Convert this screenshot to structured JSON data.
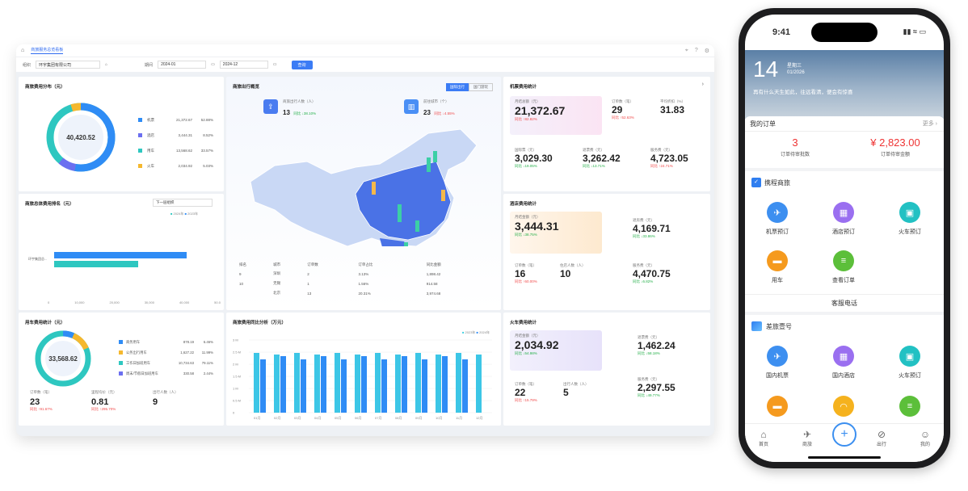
{
  "dashboard": {
    "tab": "商旅服务总览看板",
    "filter": {
      "org_label": "组织",
      "org_value": "环宇集团有限公司",
      "period_label": "期间",
      "start": "2024-01",
      "end": "2024-12",
      "search": "查询"
    },
    "spend": {
      "title": "商旅费用分布（元）",
      "total": "40,420.52",
      "items": [
        {
          "name": "机票",
          "amount": "21,372.67",
          "pct": "52.88%",
          "color": "#2f8cf5"
        },
        {
          "name": "酒店",
          "amount": "3,444.31",
          "pct": "8.52%",
          "color": "#6b6ff0"
        },
        {
          "name": "用车",
          "amount": "13,568.62",
          "pct": "33.57%",
          "color": "#2ec7c0"
        },
        {
          "name": "火车",
          "amount": "2,034.92",
          "pct": "5.03%",
          "color": "#f5b82e"
        }
      ]
    },
    "rank": {
      "title": "商旅总体费用排名（元）",
      "select": "下一层组织",
      "legend": [
        "2024年",
        "2023年"
      ],
      "category": "环宇集团总...",
      "ticks": [
        "0",
        "10,000",
        "20,000",
        "30,000",
        "40,000",
        "50.0"
      ]
    },
    "overview": {
      "title": "商旅出行概览",
      "tabs": [
        "国际出行",
        "国门游玩"
      ],
      "trips_label": "商旅出行人数（人）",
      "trips": "13",
      "trips_change": "同比 ↓38.10%",
      "cities_label": "前往城市（个）",
      "cities": "23",
      "cities_change": "同比 ↓4.55%",
      "columns": [
        "排名",
        "城市",
        "订单数",
        "订单占比",
        "同比金额"
      ],
      "rows": [
        [
          "9",
          "深圳",
          "2",
          "3.13%",
          "1,898.42"
        ],
        [
          "10",
          "无锡",
          "1",
          "1.56%",
          "914.58"
        ],
        [
          "",
          "北京",
          "13",
          "20.31%",
          "3,974.68"
        ]
      ]
    },
    "car": {
      "title": "用车费用统计（元）",
      "total": "33,568.62",
      "items": [
        {
          "name": "商务用车",
          "amount": "878.19",
          "pct": "6.46%",
          "color": "#2f8cf5"
        },
        {
          "name": "公务出行用车",
          "amount": "1,627.22",
          "pct": "11.99%",
          "color": "#f5b82e"
        },
        {
          "name": "工作日加班用车",
          "amount": "10,734.63",
          "pct": "79.11%",
          "color": "#2ec7c0"
        },
        {
          "name": "周末/节假日加班用车",
          "amount": "330.58",
          "pct": "2.44%",
          "color": "#6b6ff0"
        }
      ],
      "orders_label": "订单数（笔）",
      "orders": "23",
      "orders_change": "同比 ↑91.67%",
      "avg_label": "里程均价（元）",
      "avg": "0.81",
      "avg_change": "同比 ↑295.70%",
      "people_label": "出行人数（人）",
      "people": "9"
    },
    "yoy": {
      "title": "商旅费用同比分析（万元）",
      "legend": [
        "2023年",
        "2024年"
      ],
      "months": [
        "01月",
        "02月",
        "03月",
        "04月",
        "05月",
        "06月",
        "07月",
        "08月",
        "09月",
        "10月",
        "11月",
        "12月"
      ],
      "y_ticks": [
        "0",
        "0.5 M",
        "1 M",
        "1.5 M",
        "2 M",
        "2.5 M",
        "3 M"
      ]
    },
    "flight": {
      "title": "机票费用统计",
      "total_label": "月结总额（元）",
      "total": "21,372.67",
      "total_change": "同比 ↑82.82%",
      "orders_label": "订单数（笔）",
      "orders": "29",
      "orders_change": "同比 ↑52.63%",
      "disc_label": "平均折扣（%）",
      "disc": "31.83",
      "intl_label": "国际票（元）",
      "intl": "3,029.30",
      "intl_change": "同比 ↓19.05%",
      "change_label": "退票费（元）",
      "change": "3,262.42",
      "change_change": "同比 ↓13.71%",
      "fee_label": "服务费（元）",
      "fee": "4,723.05",
      "fee_change": "同比 ↑24.71%"
    },
    "hotel": {
      "title": "酒店费用统计",
      "total_label": "月结金额（元）",
      "total": "3,444.31",
      "total_change": "同比 ↓38.75%",
      "refund_label": "退房费（元）",
      "refund": "4,169.71",
      "refund_change": "同比 ↓33.86%",
      "orders_label": "订单数（笔）",
      "orders": "16",
      "orders_change": "同比 ↑60.00%",
      "nights_label": "住店人数（人）",
      "nights": "10",
      "fee_label": "服务费（元）",
      "fee": "4,470.75",
      "fee_change": "同比 ↓6.82%"
    },
    "train": {
      "title": "火车费用统计",
      "total_label": "月结金额（元）",
      "total": "2,034.92",
      "total_change": "同比 ↓54.98%",
      "refund_label": "退票费（元）",
      "refund": "1,462.24",
      "refund_change": "同比 ↓58.18%",
      "orders_label": "订单数（笔）",
      "orders": "22",
      "orders_change": "同比 ↑15.79%",
      "people_label": "出行人数（人）",
      "people": "5",
      "fee_label": "服务费（元）",
      "fee": "2,297.55",
      "fee_change": "同比 ↓49.77%"
    }
  },
  "phone": {
    "time": "9:41",
    "day": "14",
    "weekday": "星期三",
    "date": "01/2026",
    "slogan": "再有什么天生如此，往远看清，便会有惊喜",
    "my_orders": "我的订单",
    "more": "更多 ›",
    "pending_count": "3",
    "pending_label": "订单待审批数",
    "amount": "¥ 2,823.00",
    "amount_label": "订单待审金额",
    "section1": "携程商旅",
    "items1": [
      "机票预订",
      "酒店预订",
      "火车预订",
      "用车",
      "查看订单"
    ],
    "service": "客服电话",
    "section2": "差旅壹号",
    "items2": [
      "国内机票",
      "国内酒店",
      "火车预订"
    ],
    "nav": [
      "首页",
      "商旅",
      "",
      "出行",
      "我的"
    ]
  }
}
